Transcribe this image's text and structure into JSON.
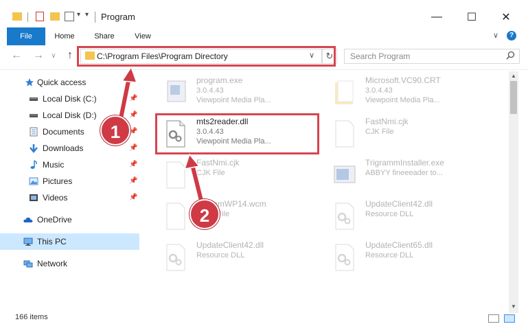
{
  "window": {
    "title": "Program",
    "minimize": "—",
    "maximize": "☐",
    "close": "✕"
  },
  "ribbon": {
    "tabs": [
      "File",
      "Home",
      "Share",
      "View"
    ],
    "expand": "∨",
    "help": "?"
  },
  "address": {
    "path": "C:\\Program Files\\Program Directory",
    "dropdown": "∨",
    "refresh": "↻"
  },
  "search": {
    "placeholder": "Search Program",
    "icon": "search-icon"
  },
  "nav": {
    "back": "←",
    "forward": "→",
    "recent": "∨",
    "up": "↑",
    "items": [
      {
        "label": "Quick access",
        "icon": "star-icon",
        "pinned": false
      },
      {
        "label": "Local Disk (C:)",
        "icon": "drive-icon",
        "pinned": true
      },
      {
        "label": "Local Disk (D:)",
        "icon": "drive-icon",
        "pinned": true
      },
      {
        "label": "Documents",
        "icon": "documents-icon",
        "pinned": true
      },
      {
        "label": "Downloads",
        "icon": "downloads-icon",
        "pinned": true
      },
      {
        "label": "Music",
        "icon": "music-icon",
        "pinned": true
      },
      {
        "label": "Pictures",
        "icon": "pictures-icon",
        "pinned": true
      },
      {
        "label": "Videos",
        "icon": "videos-icon",
        "pinned": true
      },
      {
        "label": "OneDrive",
        "icon": "cloud-icon",
        "pinned": false
      },
      {
        "label": "This PC",
        "icon": "pc-icon",
        "pinned": false
      },
      {
        "label": "Network",
        "icon": "network-icon",
        "pinned": false
      }
    ]
  },
  "files": [
    {
      "name": "program.exe",
      "line2": "3.0.4.43",
      "line3": "Viewpoint Media Pla...",
      "faded": true
    },
    {
      "name": "Microsoft.VC90.CRT",
      "line2": "3.0.4.43",
      "line3": "Viewpoint Media Pla...",
      "faded": true
    },
    {
      "name": "mts2reader.dll",
      "line2": "3.0.4.43",
      "line3": "Viewpoint Media Pla...",
      "faded": false
    },
    {
      "name": "FastNmi.cjk",
      "line2": "CJK File",
      "line3": "",
      "faded": true
    },
    {
      "name": "FastNmi.cjk",
      "line2": "CJK File",
      "line3": "",
      "faded": true
    },
    {
      "name": "TrigrammInstaller.exe",
      "line2": "ABBYY fineeeader to...",
      "line3": "",
      "faded": true
    },
    {
      "name": "TrigramWP14.wcm",
      "line2": "WCM File",
      "line3": "",
      "faded": true
    },
    {
      "name": "UpdateClient42.dll",
      "line2": "Resource DLL",
      "line3": "",
      "faded": true
    },
    {
      "name": "UpdateClient42.dll",
      "line2": "Resource DLL",
      "line3": "",
      "faded": true
    },
    {
      "name": "UpdateClient65.dll",
      "line2": "Resource DLL",
      "line3": "",
      "faded": true
    }
  ],
  "status": {
    "count": "166 items"
  },
  "callouts": [
    "1",
    "2"
  ],
  "colors": {
    "accent": "#1979ca",
    "highlight": "#d64550",
    "selected": "#cce8ff"
  }
}
